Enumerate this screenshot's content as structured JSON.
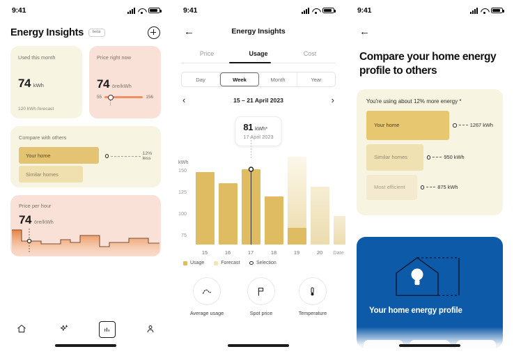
{
  "status_bar": {
    "time": "9:41",
    "icons": [
      "cellular-signal-icon",
      "wifi-icon",
      "battery-icon"
    ]
  },
  "screen1": {
    "title": "Energy Insights",
    "beta_badge": "beta",
    "add_icon": "plus-circle-icon",
    "used_card": {
      "label": "Used this month",
      "value": "74",
      "unit": "kWh",
      "forecast": "120 kWh forecast"
    },
    "price_card": {
      "label": "Price right now",
      "value": "74",
      "unit": "öre/kWh",
      "min": "55",
      "max": "156"
    },
    "compare_card": {
      "label": "Compare with others",
      "bar_your_home": "Your home",
      "bar_similar": "Similar homes",
      "annotation": "12% less"
    },
    "hour_card": {
      "label": "Price per hour",
      "value": "74",
      "unit": "öre/kWh"
    },
    "tabs": [
      {
        "name": "home-icon",
        "selected": false
      },
      {
        "name": "sparkle-icon",
        "selected": false
      },
      {
        "name": "chart-icon",
        "selected": true
      },
      {
        "name": "profile-icon",
        "selected": false
      }
    ]
  },
  "screen2": {
    "back_icon": "arrow-left-icon",
    "title": "Energy Insights",
    "tabs": [
      {
        "label": "Price",
        "active": false
      },
      {
        "label": "Usage",
        "active": true
      },
      {
        "label": "Cost",
        "active": false
      }
    ],
    "range_segments": [
      {
        "label": "Day",
        "selected": false
      },
      {
        "label": "Week",
        "selected": true
      },
      {
        "label": "Month",
        "selected": false
      },
      {
        "label": "Year",
        "selected": false
      }
    ],
    "week_label": "15 – 21 April 2023",
    "prev_icon": "chevron-left-icon",
    "next_icon": "chevron-right-icon",
    "tooltip": {
      "value": "81",
      "unit": "kWh*",
      "date": "17 April 2023"
    },
    "legend": [
      {
        "label": "Usage",
        "color": "#e0bc5f"
      },
      {
        "label": "Forecast",
        "color": "#f2e5bb"
      },
      {
        "label": "Selection",
        "color": "#1c1c1c"
      }
    ],
    "actions": [
      {
        "label": "Average usage",
        "icon": "average-usage-icon"
      },
      {
        "label": "Spot price",
        "icon": "flag-icon"
      },
      {
        "label": "Temperature",
        "icon": "thermometer-icon"
      }
    ]
  },
  "screen3": {
    "back_icon": "arrow-left-icon",
    "title": "Compare your home energy profile to others",
    "compare_card": {
      "heading": "You're using about 12% more energy *",
      "rows": [
        {
          "label": "Your home",
          "value": "1267 kWh"
        },
        {
          "label": "Similar homes",
          "value": "950 kWh"
        },
        {
          "label": "Most efficient",
          "value": "875 kWh"
        }
      ]
    },
    "blue_card": {
      "title": "Your home energy profile",
      "illustration": "house-lightbulb-icon"
    }
  },
  "chart_data": [
    {
      "type": "bar",
      "title": "Usage 15 – 21 April 2023",
      "ylabel": "kWh",
      "xlabel": "Date",
      "categories": [
        "15",
        "16",
        "17",
        "18",
        "19",
        "20",
        "21"
      ],
      "tick_labels_x": [
        "15",
        "16",
        "17",
        "18",
        "19",
        "20",
        "Date"
      ],
      "ticks_y": [
        75,
        100,
        125,
        150
      ],
      "ylim": [
        60,
        162
      ],
      "series": [
        {
          "name": "Usage",
          "values": [
            143,
            130,
            146,
            115,
            68,
            null,
            null
          ],
          "color": "#dfbc62"
        },
        {
          "name": "Forecast",
          "values": [
            null,
            null,
            null,
            null,
            160,
            127,
            89
          ],
          "color": "#f4e8c4"
        }
      ],
      "selection": {
        "category": "17",
        "value": 146,
        "label": "81 kWh*"
      },
      "grid": false,
      "legend": "bottom-left"
    },
    {
      "type": "bar",
      "title": "Compare with others",
      "categories": [
        "Your home",
        "Similar homes"
      ],
      "values": [
        100,
        80
      ],
      "annotation": "12% less",
      "colors": [
        "#e4c473",
        "#f0e0af"
      ]
    },
    {
      "type": "area",
      "title": "Price per hour",
      "ylabel": "öre/kWh",
      "values": [
        96,
        74,
        74,
        70,
        78,
        70,
        86,
        86,
        62,
        62,
        72,
        72,
        82,
        82,
        74,
        74
      ],
      "selection": {
        "index": 1,
        "value": 74
      },
      "color": "#e8823c"
    },
    {
      "type": "bar",
      "title": "Compare your home energy profile to others",
      "orientation": "horizontal",
      "categories": [
        "Your home",
        "Similar homes",
        "Most efficient"
      ],
      "values": [
        1267,
        950,
        875
      ],
      "unit": "kWh",
      "colors": [
        "#e7c76f",
        "#efe1b2",
        "#f3ead0"
      ],
      "annotation": "You're using about 12% more energy *"
    }
  ]
}
